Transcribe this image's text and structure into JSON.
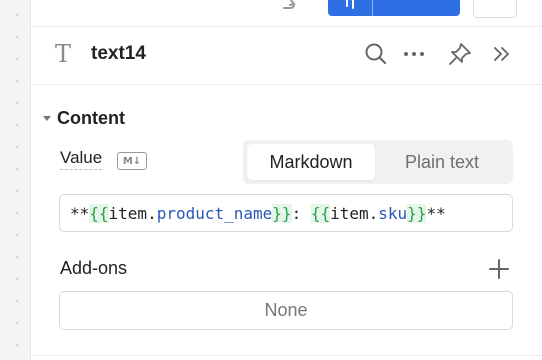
{
  "header": {
    "title": "text14",
    "type_icon": "T",
    "icons": [
      "search-icon",
      "more-icon",
      "pin-icon",
      "collapse-icon"
    ]
  },
  "content": {
    "section_title": "Content",
    "value_label": "Value",
    "markdown_badge": "M↓",
    "mode_options": [
      "Markdown",
      "Plain text"
    ],
    "selected_mode": "Markdown",
    "value_tokens": {
      "t0": "**",
      "t1": "{{",
      "t2": " item",
      "t3": ".",
      "t4": "product_name",
      "t5": "}}",
      "t6": ": ",
      "t7": "{{",
      "t8": " item",
      "t9": ".",
      "t10": "sku",
      "t11": "}}",
      "t12": "**"
    }
  },
  "addons": {
    "label": "Add-ons",
    "value": "None"
  },
  "colors": {
    "accent": "#2f6fe4",
    "template_brace": "#27a046",
    "template_property": "#2a57b7"
  }
}
